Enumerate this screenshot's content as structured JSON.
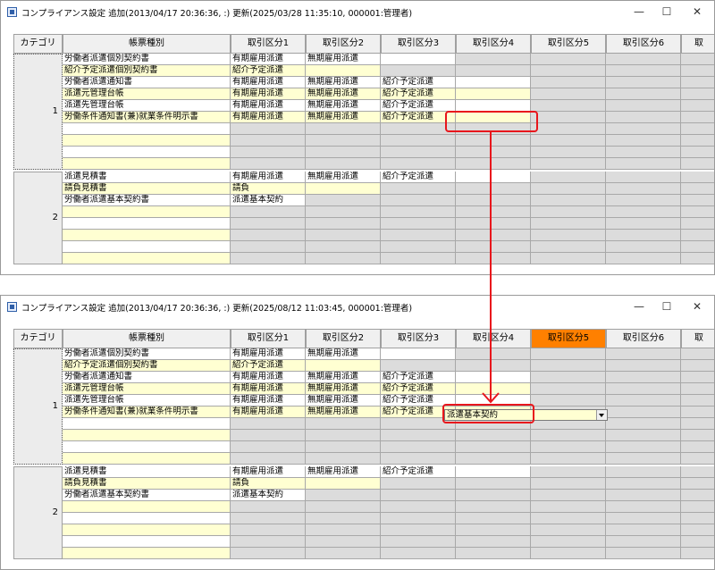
{
  "window_before": {
    "title": "コンプライアンス設定 追加(2013/04/17 20:36:36, :) 更新(2025/03/28 11:35:10, 000001:管理者)"
  },
  "window_after": {
    "title": "コンプライアンス設定 追加(2013/04/17 20:36:36, :) 更新(2025/08/12 11:03:45, 000001:管理者)"
  },
  "window_controls": {
    "minimize": "—",
    "maximize": "☐",
    "close": "✕"
  },
  "headers": [
    "カテゴリ",
    "帳票種別",
    "取引区分1",
    "取引区分2",
    "取引区分3",
    "取引区分4",
    "取引区分5",
    "取引区分6",
    "取"
  ],
  "colors": {
    "active_header": "#ff8000",
    "callout": "#e8161c",
    "editable": "#ffffd2",
    "disabled": "#dcdcdc"
  },
  "categories": [
    {
      "number": "1",
      "rows": [
        {
          "form": "労働者派遣個別契約書",
          "c1": "有期雇用派遣",
          "c2": "無期雇用派遣",
          "c3": "",
          "c4": "",
          "c5": "",
          "tone": [
            "w",
            "w",
            "w",
            "w",
            "g",
            "g",
            "g"
          ]
        },
        {
          "form": "紹介予定派遣個別契約書",
          "c1": "紹介予定派遣",
          "c2": "",
          "c3": "",
          "c4": "",
          "c5": "",
          "tone": [
            "y",
            "y",
            "y",
            "g",
            "g",
            "g",
            "g"
          ]
        },
        {
          "form": "労働者派遣通知書",
          "c1": "有期雇用派遣",
          "c2": "無期雇用派遣",
          "c3": "紹介予定派遣",
          "c4": "",
          "c5": "",
          "tone": [
            "w",
            "w",
            "w",
            "w",
            "w",
            "g",
            "g"
          ]
        },
        {
          "form": "派遣元管理台帳",
          "c1": "有期雇用派遣",
          "c2": "無期雇用派遣",
          "c3": "紹介予定派遣",
          "c4": "",
          "c5": "",
          "tone": [
            "y",
            "y",
            "y",
            "y",
            "y",
            "g",
            "g"
          ]
        },
        {
          "form": "派遣先管理台帳",
          "c1": "有期雇用派遣",
          "c2": "無期雇用派遣",
          "c3": "紹介予定派遣",
          "c4": "",
          "c5": "",
          "tone": [
            "w",
            "w",
            "w",
            "w",
            "w",
            "g",
            "g"
          ]
        },
        {
          "form": "労働条件通知書(兼)就業条件明示書",
          "c1": "有期雇用派遣",
          "c2": "無期雇用派遣",
          "c3": "紹介予定派遣",
          "c4": "",
          "c5": "",
          "tone": [
            "y",
            "y",
            "y",
            "y",
            "y",
            "g",
            "g"
          ]
        },
        {
          "form": "",
          "c1": "",
          "c2": "",
          "c3": "",
          "c4": "",
          "c5": "",
          "tone": [
            "w",
            "g",
            "g",
            "g",
            "g",
            "g",
            "g"
          ]
        },
        {
          "form": "",
          "c1": "",
          "c2": "",
          "c3": "",
          "c4": "",
          "c5": "",
          "tone": [
            "y",
            "g",
            "g",
            "g",
            "g",
            "g",
            "g"
          ]
        },
        {
          "form": "",
          "c1": "",
          "c2": "",
          "c3": "",
          "c4": "",
          "c5": "",
          "tone": [
            "w",
            "g",
            "g",
            "g",
            "g",
            "g",
            "g"
          ]
        },
        {
          "form": "",
          "c1": "",
          "c2": "",
          "c3": "",
          "c4": "",
          "c5": "",
          "tone": [
            "y",
            "g",
            "g",
            "g",
            "g",
            "g",
            "g"
          ]
        }
      ]
    },
    {
      "number": "2",
      "rows": [
        {
          "form": "派遣見積書",
          "c1": "有期雇用派遣",
          "c2": "無期雇用派遣",
          "c3": "紹介予定派遣",
          "c4": "",
          "c5": "",
          "tone": [
            "w",
            "w",
            "w",
            "w",
            "w",
            "g",
            "g"
          ]
        },
        {
          "form": "請負見積書",
          "c1": "請負",
          "c2": "",
          "c3": "",
          "c4": "",
          "c5": "",
          "tone": [
            "y",
            "y",
            "y",
            "g",
            "g",
            "g",
            "g"
          ]
        },
        {
          "form": "労働者派遣基本契約書",
          "c1": "派遣基本契約",
          "c2": "",
          "c3": "",
          "c4": "",
          "c5": "",
          "tone": [
            "w",
            "w",
            "g",
            "g",
            "g",
            "g",
            "g"
          ]
        },
        {
          "form": "",
          "c1": "",
          "c2": "",
          "c3": "",
          "c4": "",
          "c5": "",
          "tone": [
            "y",
            "g",
            "g",
            "g",
            "g",
            "g",
            "g"
          ]
        },
        {
          "form": "",
          "c1": "",
          "c2": "",
          "c3": "",
          "c4": "",
          "c5": "",
          "tone": [
            "w",
            "g",
            "g",
            "g",
            "g",
            "g",
            "g"
          ]
        },
        {
          "form": "",
          "c1": "",
          "c2": "",
          "c3": "",
          "c4": "",
          "c5": "",
          "tone": [
            "y",
            "g",
            "g",
            "g",
            "g",
            "g",
            "g"
          ]
        },
        {
          "form": "",
          "c1": "",
          "c2": "",
          "c3": "",
          "c4": "",
          "c5": "",
          "tone": [
            "w",
            "g",
            "g",
            "g",
            "g",
            "g",
            "g"
          ]
        },
        {
          "form": "",
          "c1": "",
          "c2": "",
          "c3": "",
          "c4": "",
          "c5": "",
          "tone": [
            "y",
            "g",
            "g",
            "g",
            "g",
            "g",
            "g"
          ]
        }
      ]
    }
  ],
  "dropdown": {
    "value": "派遣基本契約"
  }
}
